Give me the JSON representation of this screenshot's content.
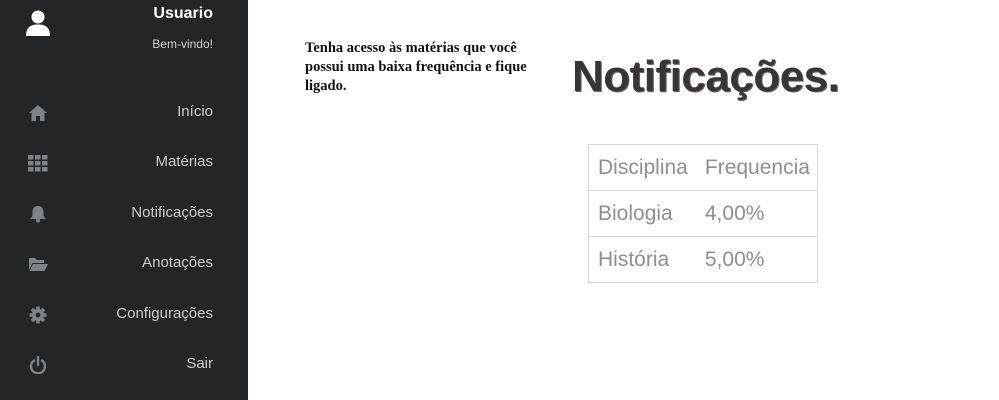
{
  "sidebar": {
    "avatar_icon": "user-icon",
    "user_name": "Usuario",
    "welcome": "Bem-vindo!",
    "items": [
      {
        "label": "Início",
        "icon": "home-icon"
      },
      {
        "label": "Matérias",
        "icon": "grid-icon"
      },
      {
        "label": "Notificações",
        "icon": "bell-icon"
      },
      {
        "label": "Anotações",
        "icon": "folder-open-icon"
      },
      {
        "label": "Configurações",
        "icon": "gear-icon"
      },
      {
        "label": "Sair",
        "icon": "power-icon"
      }
    ]
  },
  "main": {
    "intro": "Tenha acesso às matérias que você possui uma baixa frequência e fique ligado.",
    "title": "Notificações.",
    "table": {
      "headers": [
        "Disciplina",
        "Frequencia"
      ],
      "rows": [
        [
          "Biologia",
          "4,00%"
        ],
        [
          "História",
          "5,00%"
        ]
      ]
    }
  },
  "colors": {
    "sidebar_bg": "#222629",
    "sidebar_icon": "#7e8387",
    "title": "#3a3535"
  }
}
